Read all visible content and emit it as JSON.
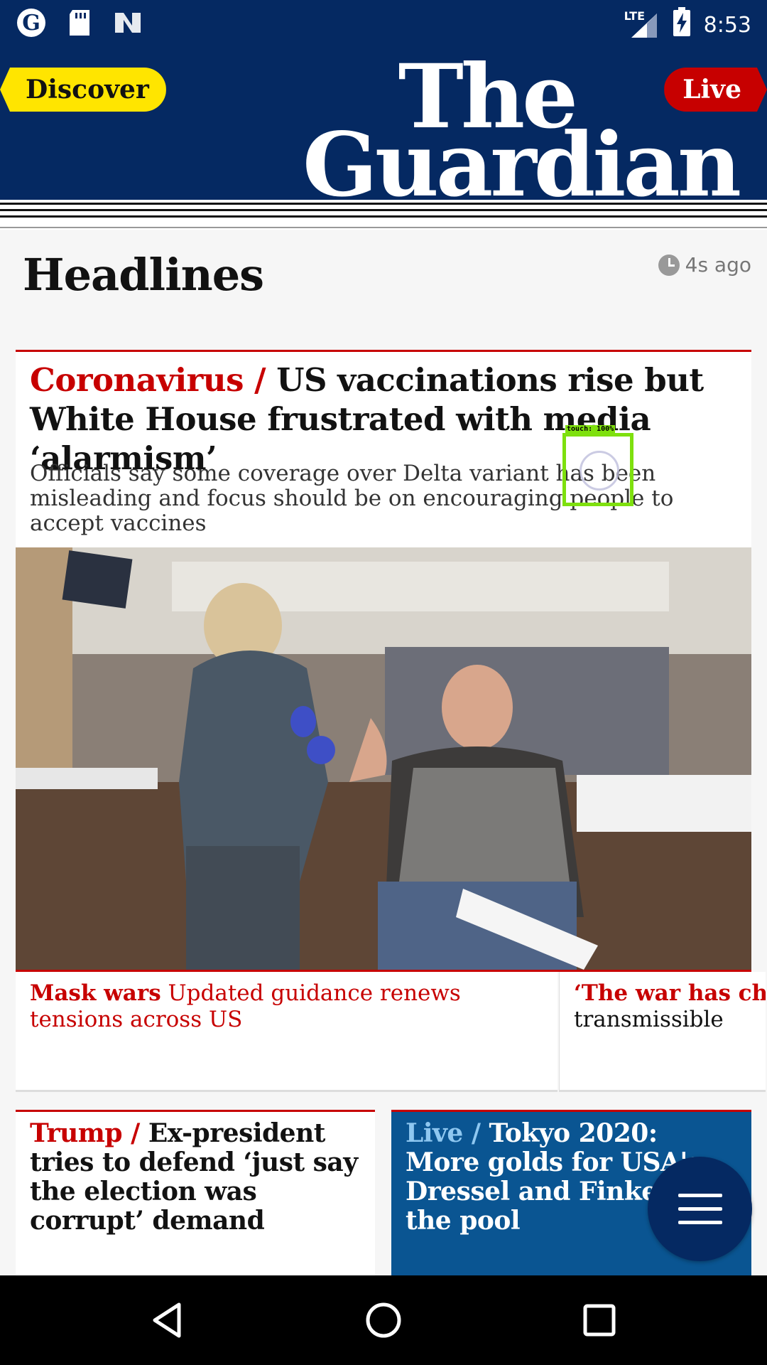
{
  "status_bar": {
    "network": "LTE",
    "time": "8:53",
    "notification_icons": [
      "guardian-g-icon",
      "sd-card-icon",
      "n-app-icon"
    ]
  },
  "header": {
    "discover_label": "Discover",
    "live_label": "Live",
    "logo_line1": "The",
    "logo_line2": "Guardian"
  },
  "headlines": {
    "title": "Headlines",
    "updated": "4s ago"
  },
  "main_story": {
    "kicker": "Coronavirus /",
    "headline": "US vaccinations rise but White House frustrated with media ‘alarmism’",
    "standfirst": "Officials say some coverage over Delta variant has been misleading and focus should be on encouraging people to accept vaccines"
  },
  "sublinks": [
    {
      "kicker": "Mask wars",
      "text": "Updated guidance renews tensions across US"
    },
    {
      "kicker": "‘The war has chan",
      "text": "transmissible"
    }
  ],
  "cards": [
    {
      "kicker": "Trump /",
      "headline": "Ex-president tries to defend ‘just say the election was corrupt’ demand"
    },
    {
      "kicker": "Live /",
      "headline": "Tokyo 2020: More golds for USA's Dressel and Finke in the pool"
    }
  ],
  "touch_overlay": {
    "label": "touch: 100%"
  },
  "colors": {
    "guardian_blue": "#052962",
    "news_red": "#c70000",
    "discover_yellow": "#ffe500",
    "live_blue": "#0a5592"
  }
}
